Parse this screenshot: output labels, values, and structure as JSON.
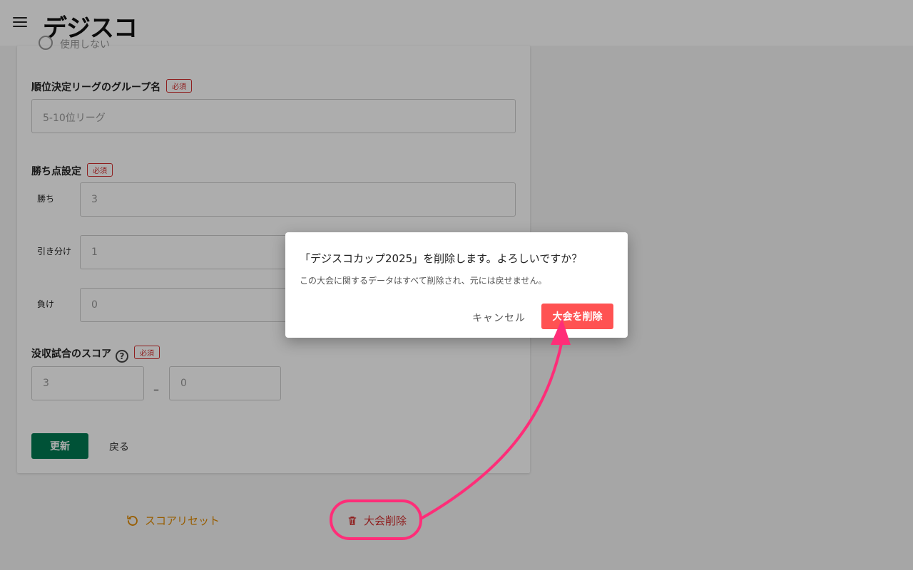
{
  "header": {
    "logo": "デジスコ",
    "menu_icon": "hamburger-menu-icon"
  },
  "form": {
    "faded_radio_label": "使用しない",
    "group_name_label": "順位決定リーグのグループ名",
    "required_badge": "必須",
    "group_name_placeholder": "5-10位リーグ",
    "points_label": "勝ち点設定",
    "win_label": "勝ち",
    "win_value": "3",
    "draw_label": "引き分け",
    "draw_value": "1",
    "loss_label": "負け",
    "loss_value": "0",
    "forfeit_label": "没収試合のスコア",
    "forfeit_help": "?",
    "forfeit_score_a": "3",
    "forfeit_separator": "–",
    "forfeit_score_b": "0",
    "update_button": "更新",
    "back_button": "戻る"
  },
  "footer_actions": {
    "reset_label": "スコアリセット",
    "delete_label": "大会削除"
  },
  "dialog": {
    "title": "「デジスコカップ2025」を削除します。よろしいですか？",
    "message": "この大会に関するデータはすべて削除され、元には戻せません。",
    "cancel_label": "キャンセル",
    "confirm_label": "大会を削除"
  },
  "colors": {
    "primary": "#007a52",
    "danger": "#ff5252",
    "warning": "#e08a00",
    "annotation": "#ff2d78"
  }
}
